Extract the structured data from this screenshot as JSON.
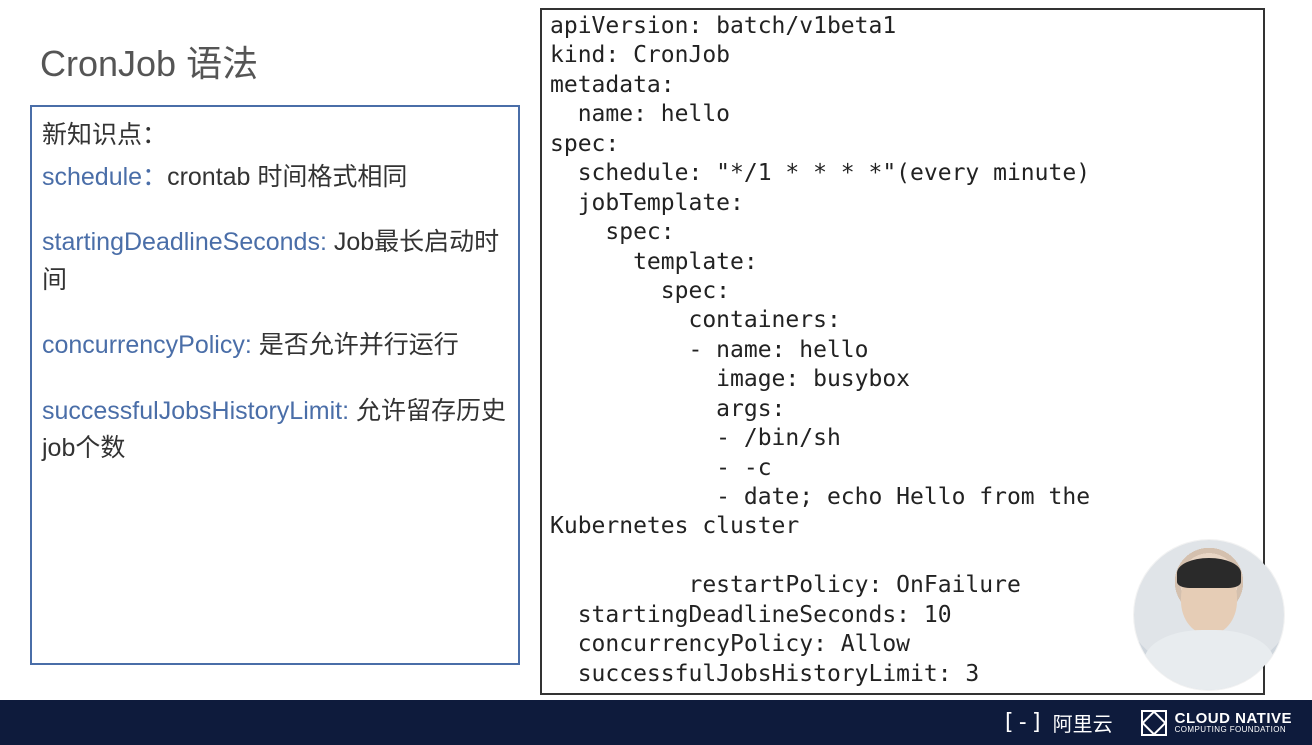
{
  "title": "CronJob 语法",
  "notes": {
    "header": "新知识点：",
    "items": [
      {
        "en": "schedule：",
        "cn": "crontab 时间格式相同"
      },
      {
        "en": "startingDeadlineSeconds:",
        "cn": " Job最长启动时间"
      },
      {
        "en": "concurrencyPolicy:",
        "cn": " 是否允许并行运行"
      },
      {
        "en": "successfulJobsHistoryLimit:",
        "cn": " 允许留存历史job个数"
      }
    ]
  },
  "code": "apiVersion: batch/v1beta1\nkind: CronJob\nmetadata:\n  name: hello\nspec:\n  schedule: \"*/1 * * * *\"(every minute)\n  jobTemplate:\n    spec:\n      template:\n        spec:\n          containers:\n          - name: hello\n            image: busybox\n            args:\n            - /bin/sh\n            - -c\n            - date; echo Hello from the\nKubernetes cluster\n\n          restartPolicy: OnFailure\n  startingDeadlineSeconds: 10\n  concurrencyPolicy: Allow\n  successfulJobsHistoryLimit: 3",
  "footer": {
    "ali_bracket": "[-]",
    "ali_text": "阿里云",
    "cn_big": "CLOUD NATIVE",
    "cn_small": "COMPUTING FOUNDATION"
  }
}
